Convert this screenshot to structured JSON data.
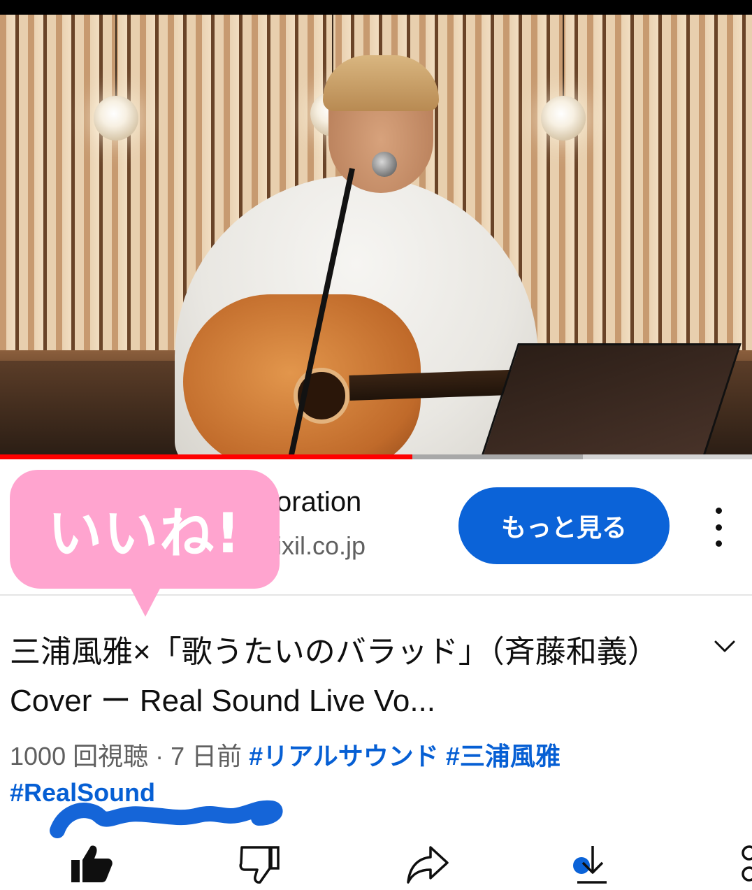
{
  "player": {
    "progress_fraction": 0.548,
    "buffer_fraction": 0.775
  },
  "channel": {
    "name_visible": "oration",
    "subtitle_visible": "ixil.co.jp",
    "more_button_label": "もっと見る"
  },
  "sticker": {
    "text": "いいね!",
    "color": "#ffa4cf"
  },
  "video": {
    "title": "三浦風雅×「歌うたいのバラッド」（斉藤和義）Cover ー Real Sound Live Vo...",
    "views": "1000 回視聴",
    "separator": " · ",
    "age": "7 日前",
    "hashtags": [
      "#リアルサウンド",
      "#三浦風雅",
      "#RealSound"
    ]
  },
  "actions": [
    {
      "icon": "like-filled-icon"
    },
    {
      "icon": "dislike-icon"
    },
    {
      "icon": "share-icon"
    },
    {
      "icon": "download-icon"
    },
    {
      "icon": "more-actions-icon"
    }
  ],
  "colors": {
    "accent_blue": "#065fd4",
    "button_blue": "#0b63d8",
    "progress_red": "#ff0000",
    "annotation_scribble": "#1565d8"
  }
}
